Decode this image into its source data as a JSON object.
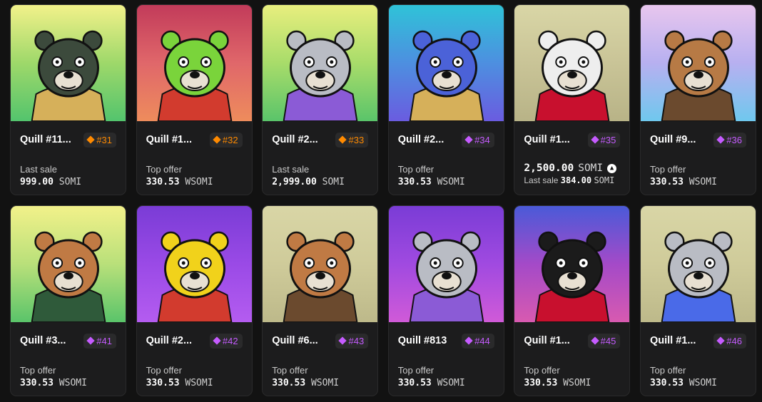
{
  "colors": {
    "background": "#121212",
    "card": "#1c1c1d",
    "rank_orange": "#ff8a00",
    "rank_purple": "#c55bff"
  },
  "cards": [
    {
      "name": "Quill #11...",
      "rank": "#31",
      "rank_color": "orange",
      "label": "Last sale",
      "price": "999.00",
      "currency": "SOMI",
      "bg": [
        "#f2f18a",
        "#9ed86a",
        "#53c46d"
      ],
      "fur": "#3c4a3c",
      "accent": "#d6b05a"
    },
    {
      "name": "Quill #1...",
      "rank": "#32",
      "rank_color": "orange",
      "label": "Top offer",
      "price": "330.53",
      "currency": "WSOMI",
      "bg": [
        "#c23b5a",
        "#e0676a",
        "#ee8c5c"
      ],
      "fur": "#7ad43b",
      "accent": "#d23b2e"
    },
    {
      "name": "Quill #2...",
      "rank": "#33",
      "rank_color": "orange",
      "label": "Last sale",
      "price": "2,999.00",
      "currency": "SOMI",
      "bg": [
        "#e8ee7e",
        "#a8dc6a",
        "#5ac46a"
      ],
      "fur": "#b9bcc4",
      "accent": "#8b5bd6"
    },
    {
      "name": "Quill #2...",
      "rank": "#34",
      "rank_color": "purple",
      "label": "Top offer",
      "price": "330.53",
      "currency": "WSOMI",
      "bg": [
        "#2fc3d8",
        "#4d8fe0",
        "#6a5ce0"
      ],
      "fur": "#4b62d8",
      "accent": "#d6b05a"
    },
    {
      "name": "Quill #1...",
      "rank": "#35",
      "rank_color": "purple",
      "big_price": "2,500.00",
      "currency": "SOMI",
      "last_sale_label": "Last sale",
      "last_sale_price": "384.00",
      "last_sale_currency": "SOMI",
      "bg": [
        "#d9d6a6",
        "#c9c497",
        "#b8b387"
      ],
      "fur": "#eeeeee",
      "accent": "#c8102e"
    },
    {
      "name": "Quill #9...",
      "rank": "#36",
      "rank_color": "purple",
      "label": "Top offer",
      "price": "330.53",
      "currency": "WSOMI",
      "bg": [
        "#e8c6ee",
        "#b7b0f0",
        "#6fc8ee"
      ],
      "fur": "#b77a45",
      "accent": "#6b4a2e"
    },
    {
      "name": "Quill #3...",
      "rank": "#41",
      "rank_color": "purple",
      "label": "Top offer",
      "price": "330.53",
      "currency": "WSOMI",
      "bg": [
        "#f2f18a",
        "#b9e07a",
        "#5ac46a"
      ],
      "fur": "#c07a44",
      "accent": "#2f5a3a"
    },
    {
      "name": "Quill #2...",
      "rank": "#42",
      "rank_color": "purple",
      "label": "Top offer",
      "price": "330.53",
      "currency": "WSOMI",
      "bg": [
        "#7a3cd6",
        "#9a4ae6",
        "#b45cf0"
      ],
      "fur": "#f1d21b",
      "accent": "#d23b2e"
    },
    {
      "name": "Quill #6...",
      "rank": "#43",
      "rank_color": "purple",
      "label": "Top offer",
      "price": "330.53",
      "currency": "WSOMI",
      "bg": [
        "#d9d6a6",
        "#cfcb9a",
        "#bdb98a"
      ],
      "fur": "#c07a44",
      "accent": "#6b4a2e"
    },
    {
      "name": "Quill #813",
      "rank": "#44",
      "rank_color": "purple",
      "label": "Top offer",
      "price": "330.53",
      "currency": "WSOMI",
      "bg": [
        "#7a3cd6",
        "#a04ae0",
        "#d05ad8"
      ],
      "fur": "#b9bcc4",
      "accent": "#8b5bd6"
    },
    {
      "name": "Quill #1...",
      "rank": "#45",
      "rank_color": "purple",
      "label": "Top offer",
      "price": "330.53",
      "currency": "WSOMI",
      "bg": [
        "#4a5ad8",
        "#a44ac8",
        "#d85ab0"
      ],
      "fur": "#1b1b1b",
      "accent": "#c8102e"
    },
    {
      "name": "Quill #1...",
      "rank": "#46",
      "rank_color": "purple",
      "label": "Top offer",
      "price": "330.53",
      "currency": "WSOMI",
      "bg": [
        "#d9d6a6",
        "#cfcb9a",
        "#bdb98a"
      ],
      "fur": "#b9bcc4",
      "accent": "#4a6ae8"
    }
  ]
}
